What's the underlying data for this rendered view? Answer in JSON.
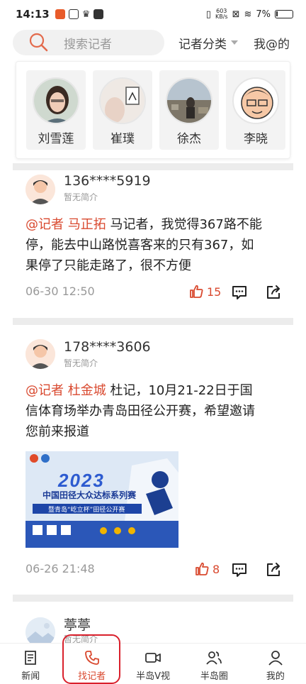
{
  "status_bar": {
    "time": "14:13",
    "net_speed_value": "603",
    "net_speed_unit": "KB/s",
    "battery": "7%"
  },
  "header": {
    "search_placeholder": "搜索记者",
    "category_label": "记者分类",
    "mine_label": "我@的"
  },
  "featured_reporters": [
    {
      "name": "刘雪莲"
    },
    {
      "name": "崔璞"
    },
    {
      "name": "徐杰"
    },
    {
      "name": "李晓"
    }
  ],
  "posts": [
    {
      "user": "136****5919",
      "bio": "暂无简介",
      "mention": "@记者 马正拓",
      "text_lines": [
        "马记者，我觉得367路不能",
        "停，能去中山路悦喜客来的只有367，如",
        "果停了只能走路了，很不方便"
      ],
      "date": "06-30 12:50",
      "likes": "15"
    },
    {
      "user": "178****3606",
      "bio": "暂无简介",
      "mention": "@记者 杜金城",
      "text_lines": [
        "杜记，10月21-22日于国",
        "信体育场举办青岛田径公开赛，希望邀请",
        "您前来报道"
      ],
      "date": "06-26 21:48",
      "likes": "8",
      "poster": {
        "year": "2023",
        "title": "中国田径大众达标系列赛",
        "subtitle": "暨青岛“屹立杯”田径公开赛"
      }
    },
    {
      "user": "葶葶",
      "bio": "暂无简介"
    }
  ],
  "tabbar": {
    "items": [
      {
        "label": "新闻"
      },
      {
        "label": "找记者"
      },
      {
        "label": "半岛V视"
      },
      {
        "label": "半岛圈"
      },
      {
        "label": "我的"
      }
    ]
  },
  "colors": {
    "accent": "#d9492f",
    "active_outline": "#d9202c",
    "divider": "#ececec"
  }
}
